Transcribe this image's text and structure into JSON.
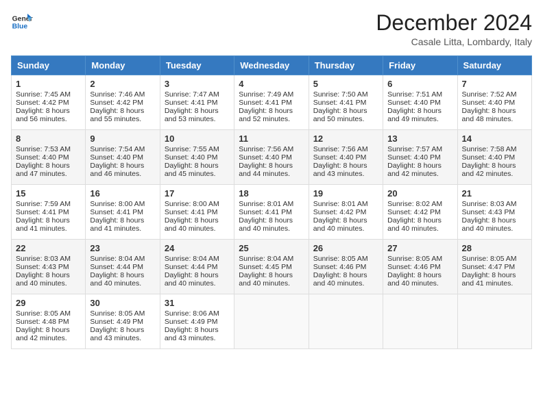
{
  "header": {
    "logo_line1": "General",
    "logo_line2": "Blue",
    "month": "December 2024",
    "location": "Casale Litta, Lombardy, Italy"
  },
  "weekdays": [
    "Sunday",
    "Monday",
    "Tuesday",
    "Wednesday",
    "Thursday",
    "Friday",
    "Saturday"
  ],
  "weeks": [
    [
      {
        "day": "1",
        "lines": [
          "Sunrise: 7:45 AM",
          "Sunset: 4:42 PM",
          "Daylight: 8 hours",
          "and 56 minutes."
        ]
      },
      {
        "day": "2",
        "lines": [
          "Sunrise: 7:46 AM",
          "Sunset: 4:42 PM",
          "Daylight: 8 hours",
          "and 55 minutes."
        ]
      },
      {
        "day": "3",
        "lines": [
          "Sunrise: 7:47 AM",
          "Sunset: 4:41 PM",
          "Daylight: 8 hours",
          "and 53 minutes."
        ]
      },
      {
        "day": "4",
        "lines": [
          "Sunrise: 7:49 AM",
          "Sunset: 4:41 PM",
          "Daylight: 8 hours",
          "and 52 minutes."
        ]
      },
      {
        "day": "5",
        "lines": [
          "Sunrise: 7:50 AM",
          "Sunset: 4:41 PM",
          "Daylight: 8 hours",
          "and 50 minutes."
        ]
      },
      {
        "day": "6",
        "lines": [
          "Sunrise: 7:51 AM",
          "Sunset: 4:40 PM",
          "Daylight: 8 hours",
          "and 49 minutes."
        ]
      },
      {
        "day": "7",
        "lines": [
          "Sunrise: 7:52 AM",
          "Sunset: 4:40 PM",
          "Daylight: 8 hours",
          "and 48 minutes."
        ]
      }
    ],
    [
      {
        "day": "8",
        "lines": [
          "Sunrise: 7:53 AM",
          "Sunset: 4:40 PM",
          "Daylight: 8 hours",
          "and 47 minutes."
        ]
      },
      {
        "day": "9",
        "lines": [
          "Sunrise: 7:54 AM",
          "Sunset: 4:40 PM",
          "Daylight: 8 hours",
          "and 46 minutes."
        ]
      },
      {
        "day": "10",
        "lines": [
          "Sunrise: 7:55 AM",
          "Sunset: 4:40 PM",
          "Daylight: 8 hours",
          "and 45 minutes."
        ]
      },
      {
        "day": "11",
        "lines": [
          "Sunrise: 7:56 AM",
          "Sunset: 4:40 PM",
          "Daylight: 8 hours",
          "and 44 minutes."
        ]
      },
      {
        "day": "12",
        "lines": [
          "Sunrise: 7:56 AM",
          "Sunset: 4:40 PM",
          "Daylight: 8 hours",
          "and 43 minutes."
        ]
      },
      {
        "day": "13",
        "lines": [
          "Sunrise: 7:57 AM",
          "Sunset: 4:40 PM",
          "Daylight: 8 hours",
          "and 42 minutes."
        ]
      },
      {
        "day": "14",
        "lines": [
          "Sunrise: 7:58 AM",
          "Sunset: 4:40 PM",
          "Daylight: 8 hours",
          "and 42 minutes."
        ]
      }
    ],
    [
      {
        "day": "15",
        "lines": [
          "Sunrise: 7:59 AM",
          "Sunset: 4:41 PM",
          "Daylight: 8 hours",
          "and 41 minutes."
        ]
      },
      {
        "day": "16",
        "lines": [
          "Sunrise: 8:00 AM",
          "Sunset: 4:41 PM",
          "Daylight: 8 hours",
          "and 41 minutes."
        ]
      },
      {
        "day": "17",
        "lines": [
          "Sunrise: 8:00 AM",
          "Sunset: 4:41 PM",
          "Daylight: 8 hours",
          "and 40 minutes."
        ]
      },
      {
        "day": "18",
        "lines": [
          "Sunrise: 8:01 AM",
          "Sunset: 4:41 PM",
          "Daylight: 8 hours",
          "and 40 minutes."
        ]
      },
      {
        "day": "19",
        "lines": [
          "Sunrise: 8:01 AM",
          "Sunset: 4:42 PM",
          "Daylight: 8 hours",
          "and 40 minutes."
        ]
      },
      {
        "day": "20",
        "lines": [
          "Sunrise: 8:02 AM",
          "Sunset: 4:42 PM",
          "Daylight: 8 hours",
          "and 40 minutes."
        ]
      },
      {
        "day": "21",
        "lines": [
          "Sunrise: 8:03 AM",
          "Sunset: 4:43 PM",
          "Daylight: 8 hours",
          "and 40 minutes."
        ]
      }
    ],
    [
      {
        "day": "22",
        "lines": [
          "Sunrise: 8:03 AM",
          "Sunset: 4:43 PM",
          "Daylight: 8 hours",
          "and 40 minutes."
        ]
      },
      {
        "day": "23",
        "lines": [
          "Sunrise: 8:04 AM",
          "Sunset: 4:44 PM",
          "Daylight: 8 hours",
          "and 40 minutes."
        ]
      },
      {
        "day": "24",
        "lines": [
          "Sunrise: 8:04 AM",
          "Sunset: 4:44 PM",
          "Daylight: 8 hours",
          "and 40 minutes."
        ]
      },
      {
        "day": "25",
        "lines": [
          "Sunrise: 8:04 AM",
          "Sunset: 4:45 PM",
          "Daylight: 8 hours",
          "and 40 minutes."
        ]
      },
      {
        "day": "26",
        "lines": [
          "Sunrise: 8:05 AM",
          "Sunset: 4:46 PM",
          "Daylight: 8 hours",
          "and 40 minutes."
        ]
      },
      {
        "day": "27",
        "lines": [
          "Sunrise: 8:05 AM",
          "Sunset: 4:46 PM",
          "Daylight: 8 hours",
          "and 40 minutes."
        ]
      },
      {
        "day": "28",
        "lines": [
          "Sunrise: 8:05 AM",
          "Sunset: 4:47 PM",
          "Daylight: 8 hours",
          "and 41 minutes."
        ]
      }
    ],
    [
      {
        "day": "29",
        "lines": [
          "Sunrise: 8:05 AM",
          "Sunset: 4:48 PM",
          "Daylight: 8 hours",
          "and 42 minutes."
        ]
      },
      {
        "day": "30",
        "lines": [
          "Sunrise: 8:05 AM",
          "Sunset: 4:49 PM",
          "Daylight: 8 hours",
          "and 43 minutes."
        ]
      },
      {
        "day": "31",
        "lines": [
          "Sunrise: 8:06 AM",
          "Sunset: 4:49 PM",
          "Daylight: 8 hours",
          "and 43 minutes."
        ]
      },
      null,
      null,
      null,
      null
    ]
  ]
}
